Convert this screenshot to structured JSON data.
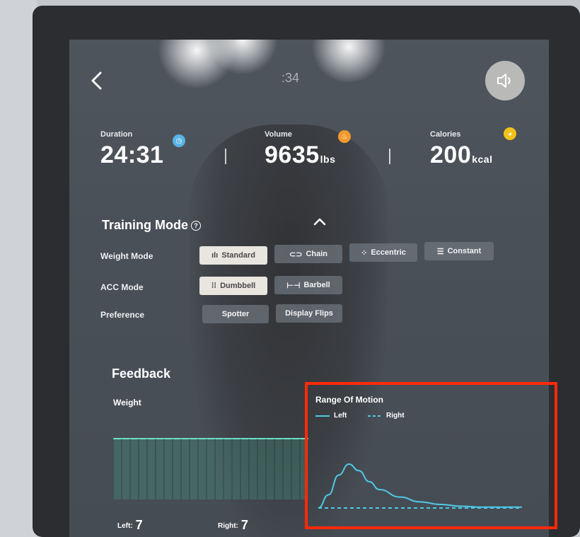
{
  "header": {
    "clock_text": ":34"
  },
  "stats": [
    {
      "label": "Duration",
      "value": "24:31",
      "unit": "",
      "color": "#5ab4e6"
    },
    {
      "label": "Volume",
      "value": "9635",
      "unit": "lbs",
      "color": "#f29a2e"
    },
    {
      "label": "Calories",
      "value": "200",
      "unit": "kcal",
      "color": "#f2c21b"
    }
  ],
  "training_mode": {
    "title": "Training Mode",
    "rows": [
      {
        "label": "Weight Mode",
        "options": [
          {
            "label": "Standard",
            "icon": "waveform-icon",
            "selected": true
          },
          {
            "label": "Chain",
            "icon": "chain-link-icon",
            "selected": false
          },
          {
            "label": "Eccentric",
            "icon": "eccentric-icon",
            "selected": false
          },
          {
            "label": "Constant",
            "icon": "constant-icon",
            "selected": false
          }
        ]
      },
      {
        "label": "ACC Mode",
        "options": [
          {
            "label": "Dumbbell",
            "icon": "dumbbell-icon",
            "selected": true
          },
          {
            "label": "Barbell",
            "icon": "barbell-icon",
            "selected": false
          }
        ]
      },
      {
        "label": "Preference",
        "options": [
          {
            "label": "Spotter",
            "icon": "",
            "selected": false
          },
          {
            "label": "Display Flips",
            "icon": "",
            "selected": false
          }
        ]
      }
    ]
  },
  "feedback": {
    "title": "Feedback",
    "weight_label": "Weight",
    "left_label": "Left:",
    "left_value": "7",
    "right_label": "Right:",
    "right_value": "7"
  },
  "chart_data": {
    "type": "line",
    "title": "Range Of Motion",
    "xlabel": "",
    "ylabel": "",
    "x": [
      0,
      0.05,
      0.1,
      0.15,
      0.2,
      0.25,
      0.3,
      0.4,
      0.5,
      0.6,
      0.7,
      0.8,
      0.9,
      1.0
    ],
    "series": [
      {
        "name": "Left",
        "style": "solid",
        "color": "#4fc8e8",
        "values": [
          0.0,
          0.3,
          0.75,
          1.0,
          0.85,
          0.6,
          0.42,
          0.25,
          0.14,
          0.08,
          0.04,
          0.02,
          0.02,
          0.02
        ]
      },
      {
        "name": "Right",
        "style": "dashed",
        "color": "#4fc8e8",
        "values": [
          0,
          0,
          0,
          0,
          0,
          0,
          0,
          0,
          0,
          0,
          0,
          0,
          0,
          0
        ]
      }
    ],
    "legend_position": "top-left",
    "grid": false
  }
}
